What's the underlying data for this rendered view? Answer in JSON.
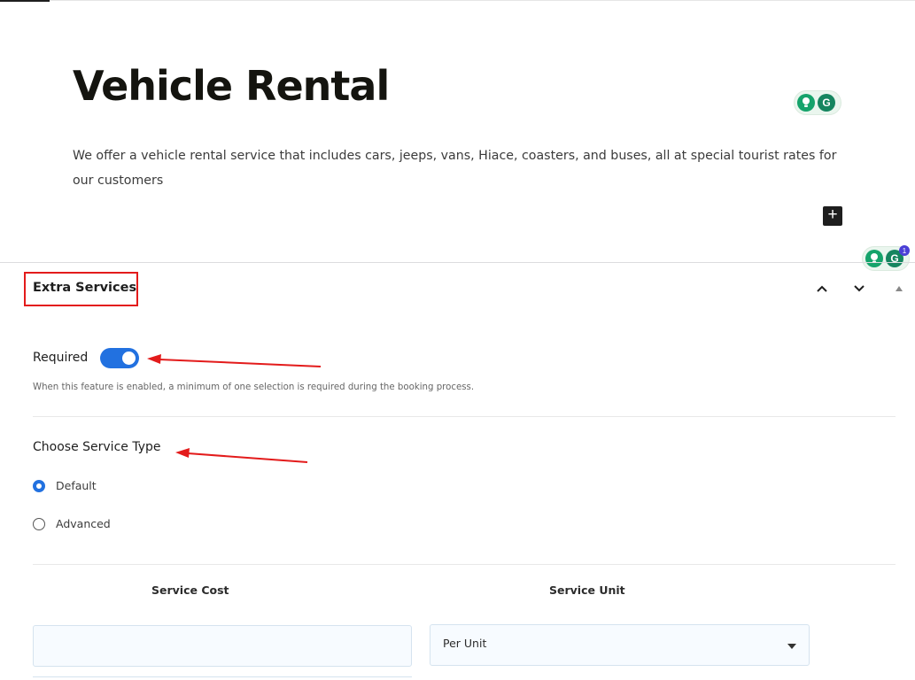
{
  "page": {
    "title": "Vehicle Rental",
    "description": "We offer a vehicle rental service that includes cars, jeeps, vans, Hiace, coasters, and buses, all at special tourist rates for our customers"
  },
  "grammarly": {
    "badge_count": "1"
  },
  "panel": {
    "title": "Extra Services",
    "required": {
      "label": "Required",
      "enabled": true,
      "help": "When this feature is enabled, a minimum of one selection is required during the booking process."
    },
    "service_type": {
      "label": "Choose Service Type",
      "options": [
        {
          "label": "Default",
          "selected": true
        },
        {
          "label": "Advanced",
          "selected": false
        }
      ]
    },
    "columns": {
      "cost": "Service Cost",
      "unit": "Service Unit"
    },
    "cost_value": "",
    "unit_value": "Per Unit"
  },
  "colors": {
    "accent": "#2271e0",
    "annotation_red": "#e31b1b",
    "grammarly_green": "#15a36b"
  }
}
